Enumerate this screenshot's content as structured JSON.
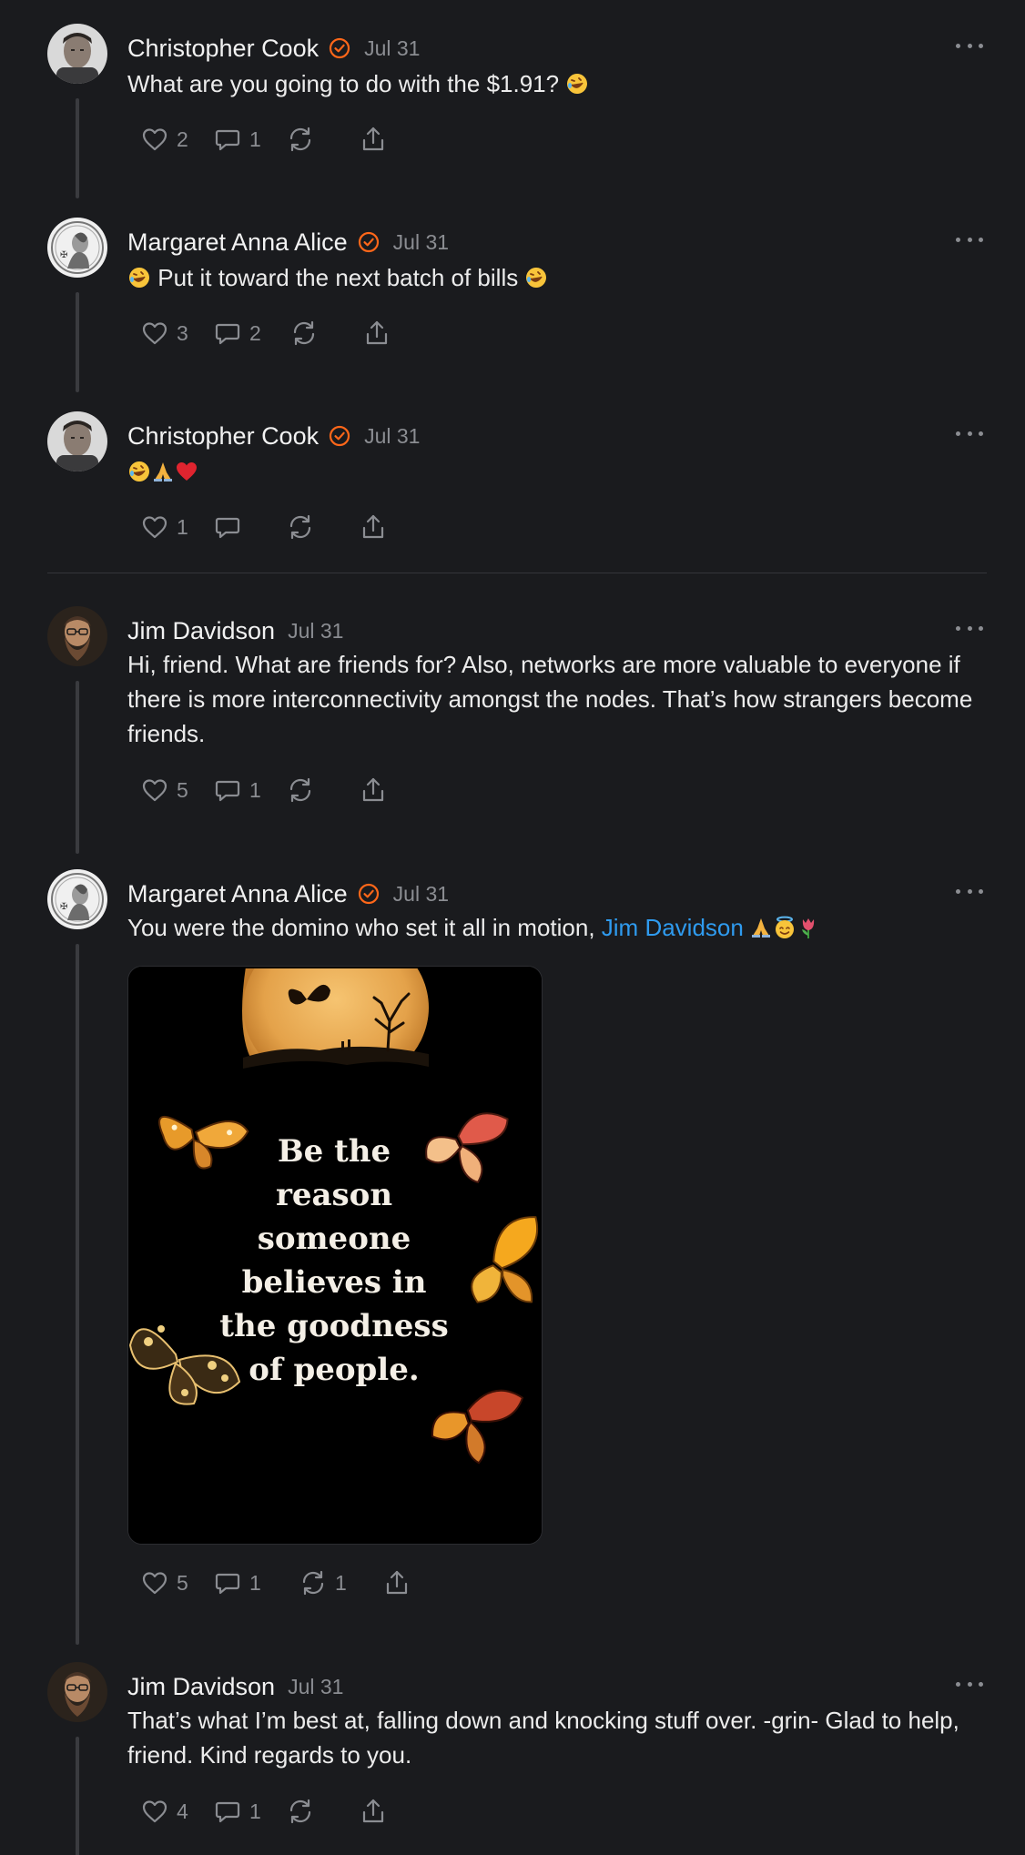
{
  "comments": [
    {
      "author": "Christopher Cook",
      "verified": true,
      "date": "Jul 31",
      "text": "What are you going to do with the $1.91? ",
      "likes": "2",
      "replies": "1",
      "restacks": "",
      "avatar": "christopher-avatar"
    },
    {
      "author": "Margaret Anna Alice",
      "verified": true,
      "date": "Jul 31",
      "text": " Put it toward the next batch of bills ",
      "likes": "3",
      "replies": "2",
      "restacks": "",
      "avatar": "margaret-avatar"
    },
    {
      "author": "Christopher Cook",
      "verified": true,
      "date": "Jul 31",
      "text": "",
      "likes": "1",
      "replies": "",
      "restacks": "",
      "avatar": "christopher-avatar"
    },
    {
      "author": "Jim Davidson",
      "verified": false,
      "date": "Jul 31",
      "text": "Hi, friend. What are friends for? Also, networks are more valuable to everyone if there is more interconnectivity amongst the nodes. That’s how strangers become friends.",
      "likes": "5",
      "replies": "1",
      "restacks": "",
      "avatar": "jim-avatar"
    },
    {
      "author": "Margaret Anna Alice",
      "verified": true,
      "date": "Jul 31",
      "text_before_mention": "You were the domino who set it all in motion, ",
      "mention": "Jim Davidson",
      "likes": "5",
      "replies": "1",
      "restacks": "1",
      "avatar": "margaret-avatar",
      "image_quote": [
        "Be the",
        "reason",
        "someone",
        "believes in",
        "the goodness",
        "of people."
      ]
    },
    {
      "author": "Jim Davidson",
      "verified": false,
      "date": "Jul 31",
      "text": "That’s what I’m best at, falling down and knocking stuff over. -grin- Glad to help, friend. Kind regards to you.",
      "likes": "4",
      "replies": "1",
      "restacks": "",
      "avatar": "jim-avatar"
    }
  ],
  "icons": {
    "verified": "verified-check-icon",
    "more": "more-horizontal-icon",
    "like": "heart-icon",
    "reply": "comment-bubble-icon",
    "restack": "restack-icon",
    "share": "share-icon"
  },
  "colors": {
    "background": "#1a1b1e",
    "accent_orange": "#ff6719",
    "mention_blue": "#2f9bef",
    "muted": "#8b8d92"
  }
}
